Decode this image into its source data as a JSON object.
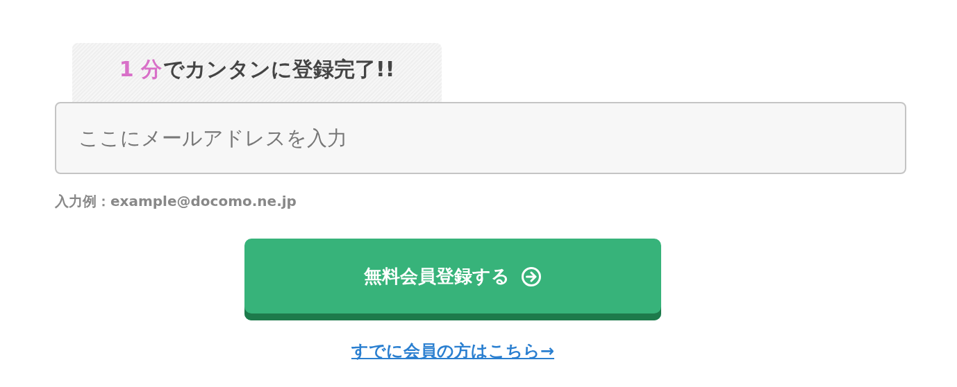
{
  "banner": {
    "highlight": "1 分",
    "text": "でカンタンに登録完了!!"
  },
  "email_field": {
    "placeholder": "ここにメールアドレスを入力"
  },
  "hint": "入力例：example@docomo.ne.jp",
  "submit_button": {
    "label": "無料会員登録する"
  },
  "login_link": "すでに会員の方はこちら→"
}
